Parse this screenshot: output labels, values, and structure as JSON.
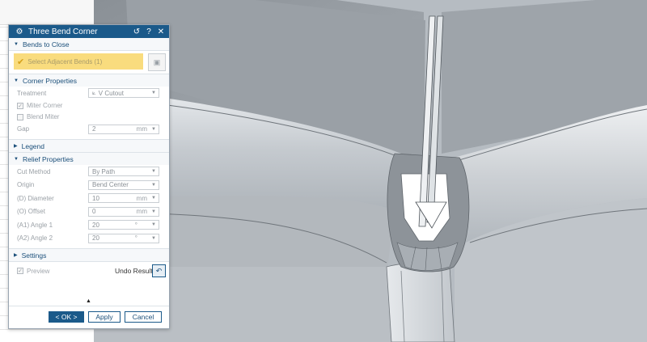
{
  "dialog": {
    "title": "Three Bend Corner",
    "icons": {
      "app": "gear-icon",
      "reset": "reset-icon",
      "help": "help-icon",
      "close": "close-icon"
    },
    "bends_to_close": {
      "header": "Bends to Close",
      "select_label": "Select Adjacent Bends (1)"
    },
    "corner_properties": {
      "header": "Corner Properties",
      "treatment_label": "Treatment",
      "treatment_value": "V Cutout",
      "miter_corner_label": "Miter Corner",
      "miter_corner_checked": true,
      "blend_miter_label": "Blend Miter",
      "blend_miter_checked": false,
      "gap_label": "Gap",
      "gap_value": "2",
      "gap_unit": "mm"
    },
    "legend": {
      "header": "Legend"
    },
    "relief_properties": {
      "header": "Relief Properties",
      "cut_method_label": "Cut Method",
      "cut_method_value": "By Path",
      "origin_label": "Origin",
      "origin_value": "Bend Center",
      "diameter_label": "(D) Diameter",
      "diameter_value": "10",
      "diameter_unit": "mm",
      "offset_label": "(O) Offset",
      "offset_value": "0",
      "offset_unit": "mm",
      "angle1_label": "(A1) Angle 1",
      "angle1_value": "20",
      "angle1_unit": "°",
      "angle2_label": "(A2) Angle 2",
      "angle2_value": "20",
      "angle2_unit": "°"
    },
    "settings": {
      "header": "Settings"
    },
    "preview_label": "Preview",
    "undo_result_label": "Undo Result",
    "buttons": {
      "ok": "< OK >",
      "apply": "Apply",
      "cancel": "Cancel"
    }
  },
  "colors": {
    "titlebar": "#1b5a8a",
    "selection_highlight": "#f9dc7e",
    "viewport_background": "#b6bcc2"
  }
}
